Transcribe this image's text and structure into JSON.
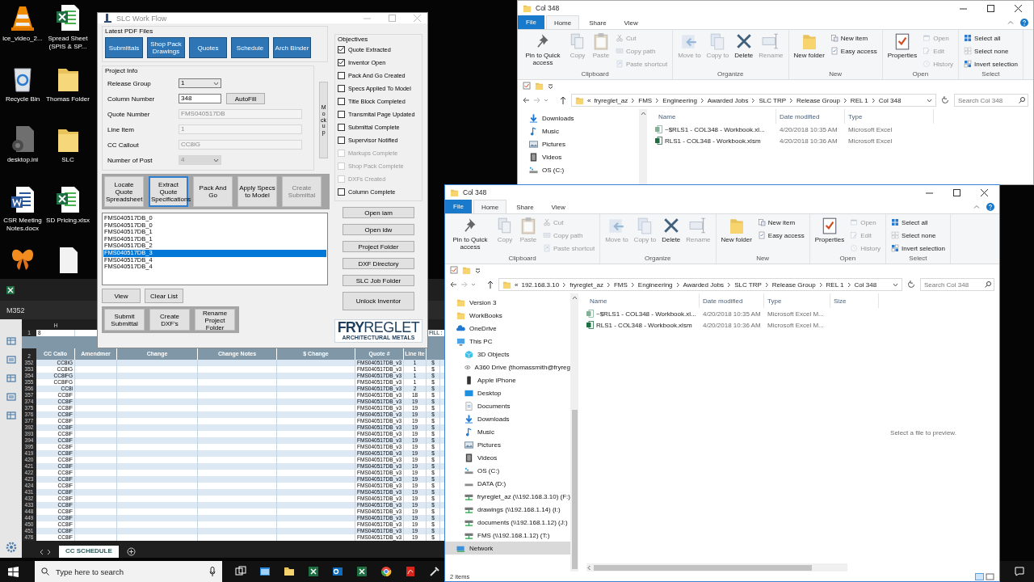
{
  "desktop": {
    "icons": [
      {
        "kind": "cone",
        "label": "ice_video_2..."
      },
      {
        "kind": "excel",
        "label": "Spread Sheet (SPIS & SP..."
      },
      {
        "kind": "bin",
        "label": "Recycle Bin"
      },
      {
        "kind": "folder",
        "label": "Thomas Folder"
      },
      {
        "kind": "gear-file",
        "label": "desktop.ini"
      },
      {
        "kind": "folder",
        "label": "SLC"
      },
      {
        "kind": "word",
        "label": "CSR Meeting Notes.docx"
      },
      {
        "kind": "excel",
        "label": "SD Pricing.xlsx"
      },
      {
        "kind": "butterfly"
      },
      {
        "kind": "blank"
      }
    ]
  },
  "excel": {
    "name_box": "M352",
    "column_letter": "H",
    "row_1": {
      "number": "1",
      "value": "8",
      "note": "FILL :"
    },
    "header_row_number": "2",
    "columns": [
      "CC Callo",
      "Amendmer",
      "Change",
      "Change Notes",
      "$ Change",
      "Quote #",
      "Line Ite"
    ],
    "rows": [
      {
        "number": "352",
        "cc_callout": "CC8iG",
        "quote": "FMS040517DB_v3",
        "line_item": "1",
        "amount": "$"
      },
      {
        "number": "353",
        "cc_callout": "CC8iG",
        "quote": "FMS040517DB_v3",
        "line_item": "1",
        "amount": "$"
      },
      {
        "number": "354",
        "cc_callout": "CC8iFG",
        "quote": "FMS040517DB_v3",
        "line_item": "1",
        "amount": "$"
      },
      {
        "number": "355",
        "cc_callout": "CC8iFG",
        "quote": "FMS040517DB_v3",
        "line_item": "1",
        "amount": "$"
      },
      {
        "number": "356",
        "cc_callout": "CC8i",
        "quote": "FMS040517DB_v3",
        "line_item": "2",
        "amount": "$"
      },
      {
        "number": "357",
        "cc_callout": "CC8iF",
        "quote": "FMS040517DB_v3",
        "line_item": "18",
        "amount": "$"
      },
      {
        "number": "374",
        "cc_callout": "CC8iF",
        "quote": "FMS040517DB_v3",
        "line_item": "19",
        "amount": "$"
      },
      {
        "number": "375",
        "cc_callout": "CC8iF",
        "quote": "FMS040517DB_v3",
        "line_item": "19",
        "amount": "$"
      },
      {
        "number": "376",
        "cc_callout": "CC8iF",
        "quote": "FMS040517DB_v3",
        "line_item": "19",
        "amount": "$"
      },
      {
        "number": "377",
        "cc_callout": "CC8iF",
        "quote": "FMS040517DB_v3",
        "line_item": "19",
        "amount": "$"
      },
      {
        "number": "392",
        "cc_callout": "CC8iF",
        "quote": "FMS040517DB_v3",
        "line_item": "19",
        "amount": "$"
      },
      {
        "number": "393",
        "cc_callout": "CC8iF",
        "quote": "FMS040517DB_v3",
        "line_item": "19",
        "amount": "$"
      },
      {
        "number": "394",
        "cc_callout": "CC8iF",
        "quote": "FMS040517DB_v3",
        "line_item": "19",
        "amount": "$"
      },
      {
        "number": "395",
        "cc_callout": "CC8iF",
        "quote": "FMS040517DB_v3",
        "line_item": "19",
        "amount": "$"
      },
      {
        "number": "419",
        "cc_callout": "CC8iF",
        "quote": "FMS040517DB_v3",
        "line_item": "19",
        "amount": "$"
      },
      {
        "number": "420",
        "cc_callout": "CC8iF",
        "quote": "FMS040517DB_v3",
        "line_item": "19",
        "amount": "$"
      },
      {
        "number": "421",
        "cc_callout": "CC8iF",
        "quote": "FMS040517DB_v3",
        "line_item": "19",
        "amount": "$"
      },
      {
        "number": "422",
        "cc_callout": "CC8iF",
        "quote": "FMS040517DB_v3",
        "line_item": "19",
        "amount": "$"
      },
      {
        "number": "423",
        "cc_callout": "CC8iF",
        "quote": "FMS040517DB_v3",
        "line_item": "19",
        "amount": "$"
      },
      {
        "number": "424",
        "cc_callout": "CC8iF",
        "quote": "FMS040517DB_v3",
        "line_item": "19",
        "amount": "$"
      },
      {
        "number": "431",
        "cc_callout": "CC8iF",
        "quote": "FMS040517DB_v3",
        "line_item": "19",
        "amount": "$"
      },
      {
        "number": "432",
        "cc_callout": "CC8iF",
        "quote": "FMS040517DB_v3",
        "line_item": "19",
        "amount": "$"
      },
      {
        "number": "433",
        "cc_callout": "CC8iF",
        "quote": "FMS040517DB_v3",
        "line_item": "19",
        "amount": "$"
      },
      {
        "number": "448",
        "cc_callout": "CC8iF",
        "quote": "FMS040517DB_v3",
        "line_item": "19",
        "amount": "$"
      },
      {
        "number": "449",
        "cc_callout": "CC8iF",
        "quote": "FMS040517DB_v3",
        "line_item": "19",
        "amount": "$"
      },
      {
        "number": "450",
        "cc_callout": "CC8iF",
        "quote": "FMS040517DB_v3",
        "line_item": "19",
        "amount": "$"
      },
      {
        "number": "451",
        "cc_callout": "CC8iF",
        "quote": "FMS040517DB_v3",
        "line_item": "19",
        "amount": "$"
      },
      {
        "number": "476",
        "cc_callout": "CC8iF",
        "quote": "FMS040517DB_v3",
        "line_item": "19",
        "amount": "$"
      }
    ],
    "sheet_tab": "CC SCHEDULE"
  },
  "explorer_back": {
    "title": "Col 348",
    "tabs": [
      {
        "label": "File",
        "kind": "file",
        "selected": false
      },
      {
        "label": "Home",
        "kind": "tab",
        "selected": true
      },
      {
        "label": "Share",
        "kind": "tab",
        "selected": false
      },
      {
        "label": "View",
        "kind": "tab",
        "selected": false
      }
    ],
    "ribbon": [
      {
        "label": "Clipboard",
        "items": [
          {
            "label": "Pin to Quick access",
            "kind": "pin",
            "large": true,
            "disabled": false
          },
          {
            "label": "Copy",
            "kind": "copy",
            "large": true,
            "disabled": true
          },
          {
            "label": "Paste",
            "kind": "paste",
            "large": true,
            "disabled": true
          },
          {
            "label": "Cut",
            "kind": "cut",
            "large": false,
            "disabled": true
          },
          {
            "label": "Copy path",
            "kind": "copy-path",
            "large": false,
            "disabled": true
          },
          {
            "label": "Paste shortcut",
            "kind": "paste-shortcut",
            "large": false,
            "disabled": true
          }
        ]
      },
      {
        "label": "Organize",
        "items": [
          {
            "label": "Move to",
            "kind": "move",
            "large": true,
            "disabled": true
          },
          {
            "label": "Copy to",
            "kind": "copy-to",
            "large": true,
            "disabled": true
          },
          {
            "label": "Delete",
            "kind": "delete",
            "large": true,
            "disabled": false
          },
          {
            "label": "Rename",
            "kind": "rename",
            "large": true,
            "disabled": true
          }
        ]
      },
      {
        "label": "New",
        "items": [
          {
            "label": "New folder",
            "kind": "new-folder",
            "large": true,
            "disabled": false
          },
          {
            "label": "New item",
            "kind": "new-item",
            "large": false,
            "disabled": false
          },
          {
            "label": "Easy access",
            "kind": "easy-access",
            "large": false,
            "disabled": false
          }
        ]
      },
      {
        "label": "Open",
        "items": [
          {
            "label": "Properties",
            "kind": "properties",
            "large": true,
            "disabled": false
          },
          {
            "label": "Open",
            "kind": "open",
            "large": false,
            "disabled": true
          },
          {
            "label": "Edit",
            "kind": "edit",
            "large": false,
            "disabled": true
          },
          {
            "label": "History",
            "kind": "history",
            "large": false,
            "disabled": true
          }
        ]
      },
      {
        "label": "Select",
        "items": [
          {
            "label": "Select all",
            "kind": "select-all",
            "large": false,
            "disabled": false
          },
          {
            "label": "Select none",
            "kind": "select-none",
            "large": false,
            "disabled": false
          },
          {
            "label": "Invert selection",
            "kind": "invert",
            "large": false,
            "disabled": false
          }
        ]
      }
    ],
    "overflow_mark": "«",
    "path": [
      "fryreglet_az",
      "FMS",
      "Engineering",
      "Awarded Jobs",
      "SLC TRP",
      "Release Group",
      "REL 1",
      "Col 348"
    ],
    "search": {
      "placeholder": "Search Col 348"
    },
    "nav": [
      {
        "label": "Downloads",
        "kind": "downloads",
        "selected": false
      },
      {
        "label": "Music",
        "kind": "music",
        "selected": false
      },
      {
        "label": "Pictures",
        "kind": "pictures",
        "selected": false
      },
      {
        "label": "Videos",
        "kind": "videos",
        "selected": false
      },
      {
        "label": "OS (C:)",
        "kind": "disk",
        "selected": false
      }
    ],
    "columns": [
      "Name",
      "Date modified",
      "Type"
    ],
    "files": [
      {
        "name": "~$RLS1 - COL348 - Workbook.xl...",
        "date": "4/20/2018 10:35 AM",
        "type": "Microsoft Excel",
        "kind": "temp"
      },
      {
        "name": "RLS1 - COL348 - Workbook.xlsm",
        "date": "4/20/2018 10:36 AM",
        "type": "Microsoft Excel",
        "kind": "workbook"
      }
    ]
  },
  "workflow": {
    "title": "SLC Work Flow",
    "pdf_group": {
      "label": "Latest PDF Files",
      "buttons": [
        "Submittals",
        "Shop Pack Drawings",
        "Quotes",
        "Schedule",
        "Arch Binder"
      ]
    },
    "project_info": {
      "label": "Project Info",
      "fields": [
        {
          "label": "Release Group",
          "kind": "select",
          "value": "1",
          "disabled": false
        },
        {
          "label": "Column Number",
          "kind": "input",
          "value": "348",
          "disabled": false,
          "action": "AutoFill"
        },
        {
          "label": "Quote Number",
          "kind": "input",
          "value": "FMS040517DB",
          "disabled": true
        },
        {
          "label": "Line Item",
          "kind": "input",
          "value": "1",
          "disabled": true
        },
        {
          "label": "CC Callout",
          "kind": "input",
          "value": "CC8iG",
          "disabled": true
        },
        {
          "label": "Number of Post",
          "kind": "select",
          "value": "4",
          "disabled": true
        }
      ],
      "side_button": "Mockup"
    },
    "actions": [
      {
        "label": "Locate Quote Spreadsheet",
        "focused": false,
        "disabled": false
      },
      {
        "label": "Extract Quote Specifications",
        "focused": true,
        "disabled": false
      },
      {
        "label": "Pack And Go",
        "focused": false,
        "disabled": false
      },
      {
        "label": "Apply Specs to Model",
        "focused": false,
        "disabled": false
      },
      {
        "label": "Create Submittal",
        "focused": false,
        "disabled": true
      }
    ],
    "list": [
      {
        "text": "FMS040517DB_0",
        "selected": false
      },
      {
        "text": "FMS040517DB_0",
        "selected": false
      },
      {
        "text": "FMS040517DB_1",
        "selected": false
      },
      {
        "text": "FMS040517DB_1",
        "selected": false
      },
      {
        "text": "FMS040517DB_2",
        "selected": false
      },
      {
        "text": "FMS040517DB_3",
        "selected": true
      },
      {
        "text": "FMS040517DB_4",
        "selected": false
      },
      {
        "text": "FMS040517DB_4",
        "selected": false
      }
    ],
    "list_buttons": [
      "View",
      "Clear List"
    ],
    "bottom_actions": [
      "Submit Submittal",
      "Create DXF's",
      "Rename Project Folder"
    ],
    "objectives": {
      "label": "Objectives",
      "items": [
        {
          "label": "Quote Extracted",
          "checked": true,
          "disabled": false
        },
        {
          "label": "Inventor Open",
          "checked": true,
          "disabled": false
        },
        {
          "label": "Pack And Go Created",
          "checked": false,
          "disabled": false
        },
        {
          "label": "Specs Applied To Model",
          "checked": false,
          "disabled": false
        },
        {
          "label": "Title Block Completed",
          "checked": false,
          "disabled": false
        },
        {
          "label": "Transmital Page Updated",
          "checked": false,
          "disabled": false
        },
        {
          "label": "Submittal Complete",
          "checked": false,
          "disabled": false
        },
        {
          "label": "Supervisor Notified",
          "checked": false,
          "disabled": false
        },
        {
          "label": "Markups Complete",
          "checked": false,
          "disabled": true
        },
        {
          "label": "Shop Pack Complete",
          "checked": false,
          "disabled": true
        },
        {
          "label": "DXFs Created",
          "checked": false,
          "disabled": true
        },
        {
          "label": "Column Complete",
          "checked": false,
          "disabled": false
        }
      ]
    },
    "side_buttons": [
      "Open iam",
      "Open idw",
      "Project Folder",
      "DXF Directory",
      "SLC Job Folder",
      "Unlock Inventor"
    ],
    "logo": {
      "bold": "FRY",
      "light": "REGLET",
      "tagline": "ARCHITECTURAL METALS"
    }
  },
  "explorer_front": {
    "title": "Col 348",
    "tabs": [
      {
        "label": "File",
        "kind": "file",
        "selected": false
      },
      {
        "label": "Home",
        "kind": "tab",
        "selected": true
      },
      {
        "label": "Share",
        "kind": "tab",
        "selected": false
      },
      {
        "label": "View",
        "kind": "tab",
        "selected": false
      }
    ],
    "ribbon": [
      {
        "label": "Clipboard",
        "items": [
          {
            "label": "Pin to Quick access",
            "kind": "pin",
            "large": true,
            "disabled": false
          },
          {
            "label": "Copy",
            "kind": "copy",
            "large": true,
            "disabled": true
          },
          {
            "label": "Paste",
            "kind": "paste",
            "large": true,
            "disabled": true
          },
          {
            "label": "Cut",
            "kind": "cut",
            "large": false,
            "disabled": true
          },
          {
            "label": "Copy path",
            "kind": "copy-path",
            "large": false,
            "disabled": true
          },
          {
            "label": "Paste shortcut",
            "kind": "paste-shortcut",
            "large": false,
            "disabled": true
          }
        ]
      },
      {
        "label": "Organize",
        "items": [
          {
            "label": "Move to",
            "kind": "move",
            "large": true,
            "disabled": true
          },
          {
            "label": "Copy to",
            "kind": "copy-to",
            "large": true,
            "disabled": true
          },
          {
            "label": "Delete",
            "kind": "delete",
            "large": true,
            "disabled": false
          },
          {
            "label": "Rename",
            "kind": "rename",
            "large": true,
            "disabled": true
          }
        ]
      },
      {
        "label": "New",
        "items": [
          {
            "label": "New folder",
            "kind": "new-folder",
            "large": true,
            "disabled": false
          },
          {
            "label": "New item",
            "kind": "new-item",
            "large": false,
            "disabled": false
          },
          {
            "label": "Easy access",
            "kind": "easy-access",
            "large": false,
            "disabled": false
          }
        ]
      },
      {
        "label": "Open",
        "items": [
          {
            "label": "Properties",
            "kind": "properties",
            "large": true,
            "disabled": false
          },
          {
            "label": "Open",
            "kind": "open",
            "large": false,
            "disabled": true
          },
          {
            "label": "Edit",
            "kind": "edit",
            "large": false,
            "disabled": true
          },
          {
            "label": "History",
            "kind": "history",
            "large": false,
            "disabled": true
          }
        ]
      },
      {
        "label": "Select",
        "items": [
          {
            "label": "Select all",
            "kind": "select-all",
            "large": false,
            "disabled": false
          },
          {
            "label": "Select none",
            "kind": "select-none",
            "large": false,
            "disabled": false
          },
          {
            "label": "Invert selection",
            "kind": "invert",
            "large": false,
            "disabled": false
          }
        ]
      }
    ],
    "overflow_mark": "«",
    "path": [
      "192.168.3.10",
      "fryreglet_az",
      "FMS",
      "Engineering",
      "Awarded Jobs",
      "SLC TRP",
      "Release Group",
      "REL 1",
      "Col 348"
    ],
    "search": {
      "placeholder": "Search Col 348"
    },
    "nav": [
      {
        "label": "Version 3",
        "kind": "folder",
        "selected": false
      },
      {
        "label": "WorkBooks",
        "kind": "folder",
        "selected": false
      },
      {
        "label": "OneDrive",
        "kind": "cloud",
        "selected": false
      },
      {
        "label": "This PC",
        "kind": "pc",
        "selected": false,
        "children": [
          {
            "label": "3D Objects",
            "kind": "cube",
            "selected": false
          },
          {
            "label": "A360 Drive (thomassmith@fryreg",
            "kind": "a360",
            "selected": false
          },
          {
            "label": "Apple iPhone",
            "kind": "phone",
            "selected": false
          },
          {
            "label": "Desktop",
            "kind": "desktop",
            "selected": false
          },
          {
            "label": "Documents",
            "kind": "documents",
            "selected": false
          },
          {
            "label": "Downloads",
            "kind": "downloads",
            "selected": false
          },
          {
            "label": "Music",
            "kind": "music",
            "selected": false
          },
          {
            "label": "Pictures",
            "kind": "pictures",
            "selected": false
          },
          {
            "label": "Videos",
            "kind": "videos",
            "selected": false
          },
          {
            "label": "OS (C:)",
            "kind": "disk",
            "selected": false
          },
          {
            "label": "DATA (D:)",
            "kind": "drive",
            "selected": false
          },
          {
            "label": "fryreglet_az (\\\\192.168.3.10) (F:)",
            "kind": "netdrive",
            "selected": false
          },
          {
            "label": "drawings (\\\\192.168.1.14) (I:)",
            "kind": "netdrive",
            "selected": false
          },
          {
            "label": "documents (\\\\192.168.1.12) (J:)",
            "kind": "netdrive",
            "selected": false
          },
          {
            "label": "FMS (\\\\192.168.1.12) (T:)",
            "kind": "netdrive",
            "selected": false
          }
        ]
      },
      {
        "label": "Network",
        "kind": "network",
        "selected": true
      }
    ],
    "columns": [
      "Name",
      "Date modified",
      "Type",
      "Size"
    ],
    "files": [
      {
        "name": "~$RLS1 - COL348 - Workbook.xl...",
        "date": "4/20/2018 10:35 AM",
        "type": "Microsoft Excel M...",
        "kind": "temp"
      },
      {
        "name": "RLS1 - COL348 - Workbook.xlsm",
        "date": "4/20/2018 10:36 AM",
        "type": "Microsoft Excel M...",
        "kind": "workbook"
      }
    ],
    "preview": "Select a file to preview.",
    "status": "2 items"
  },
  "taskbar": {
    "search": {
      "placeholder": "Type here to search"
    }
  }
}
